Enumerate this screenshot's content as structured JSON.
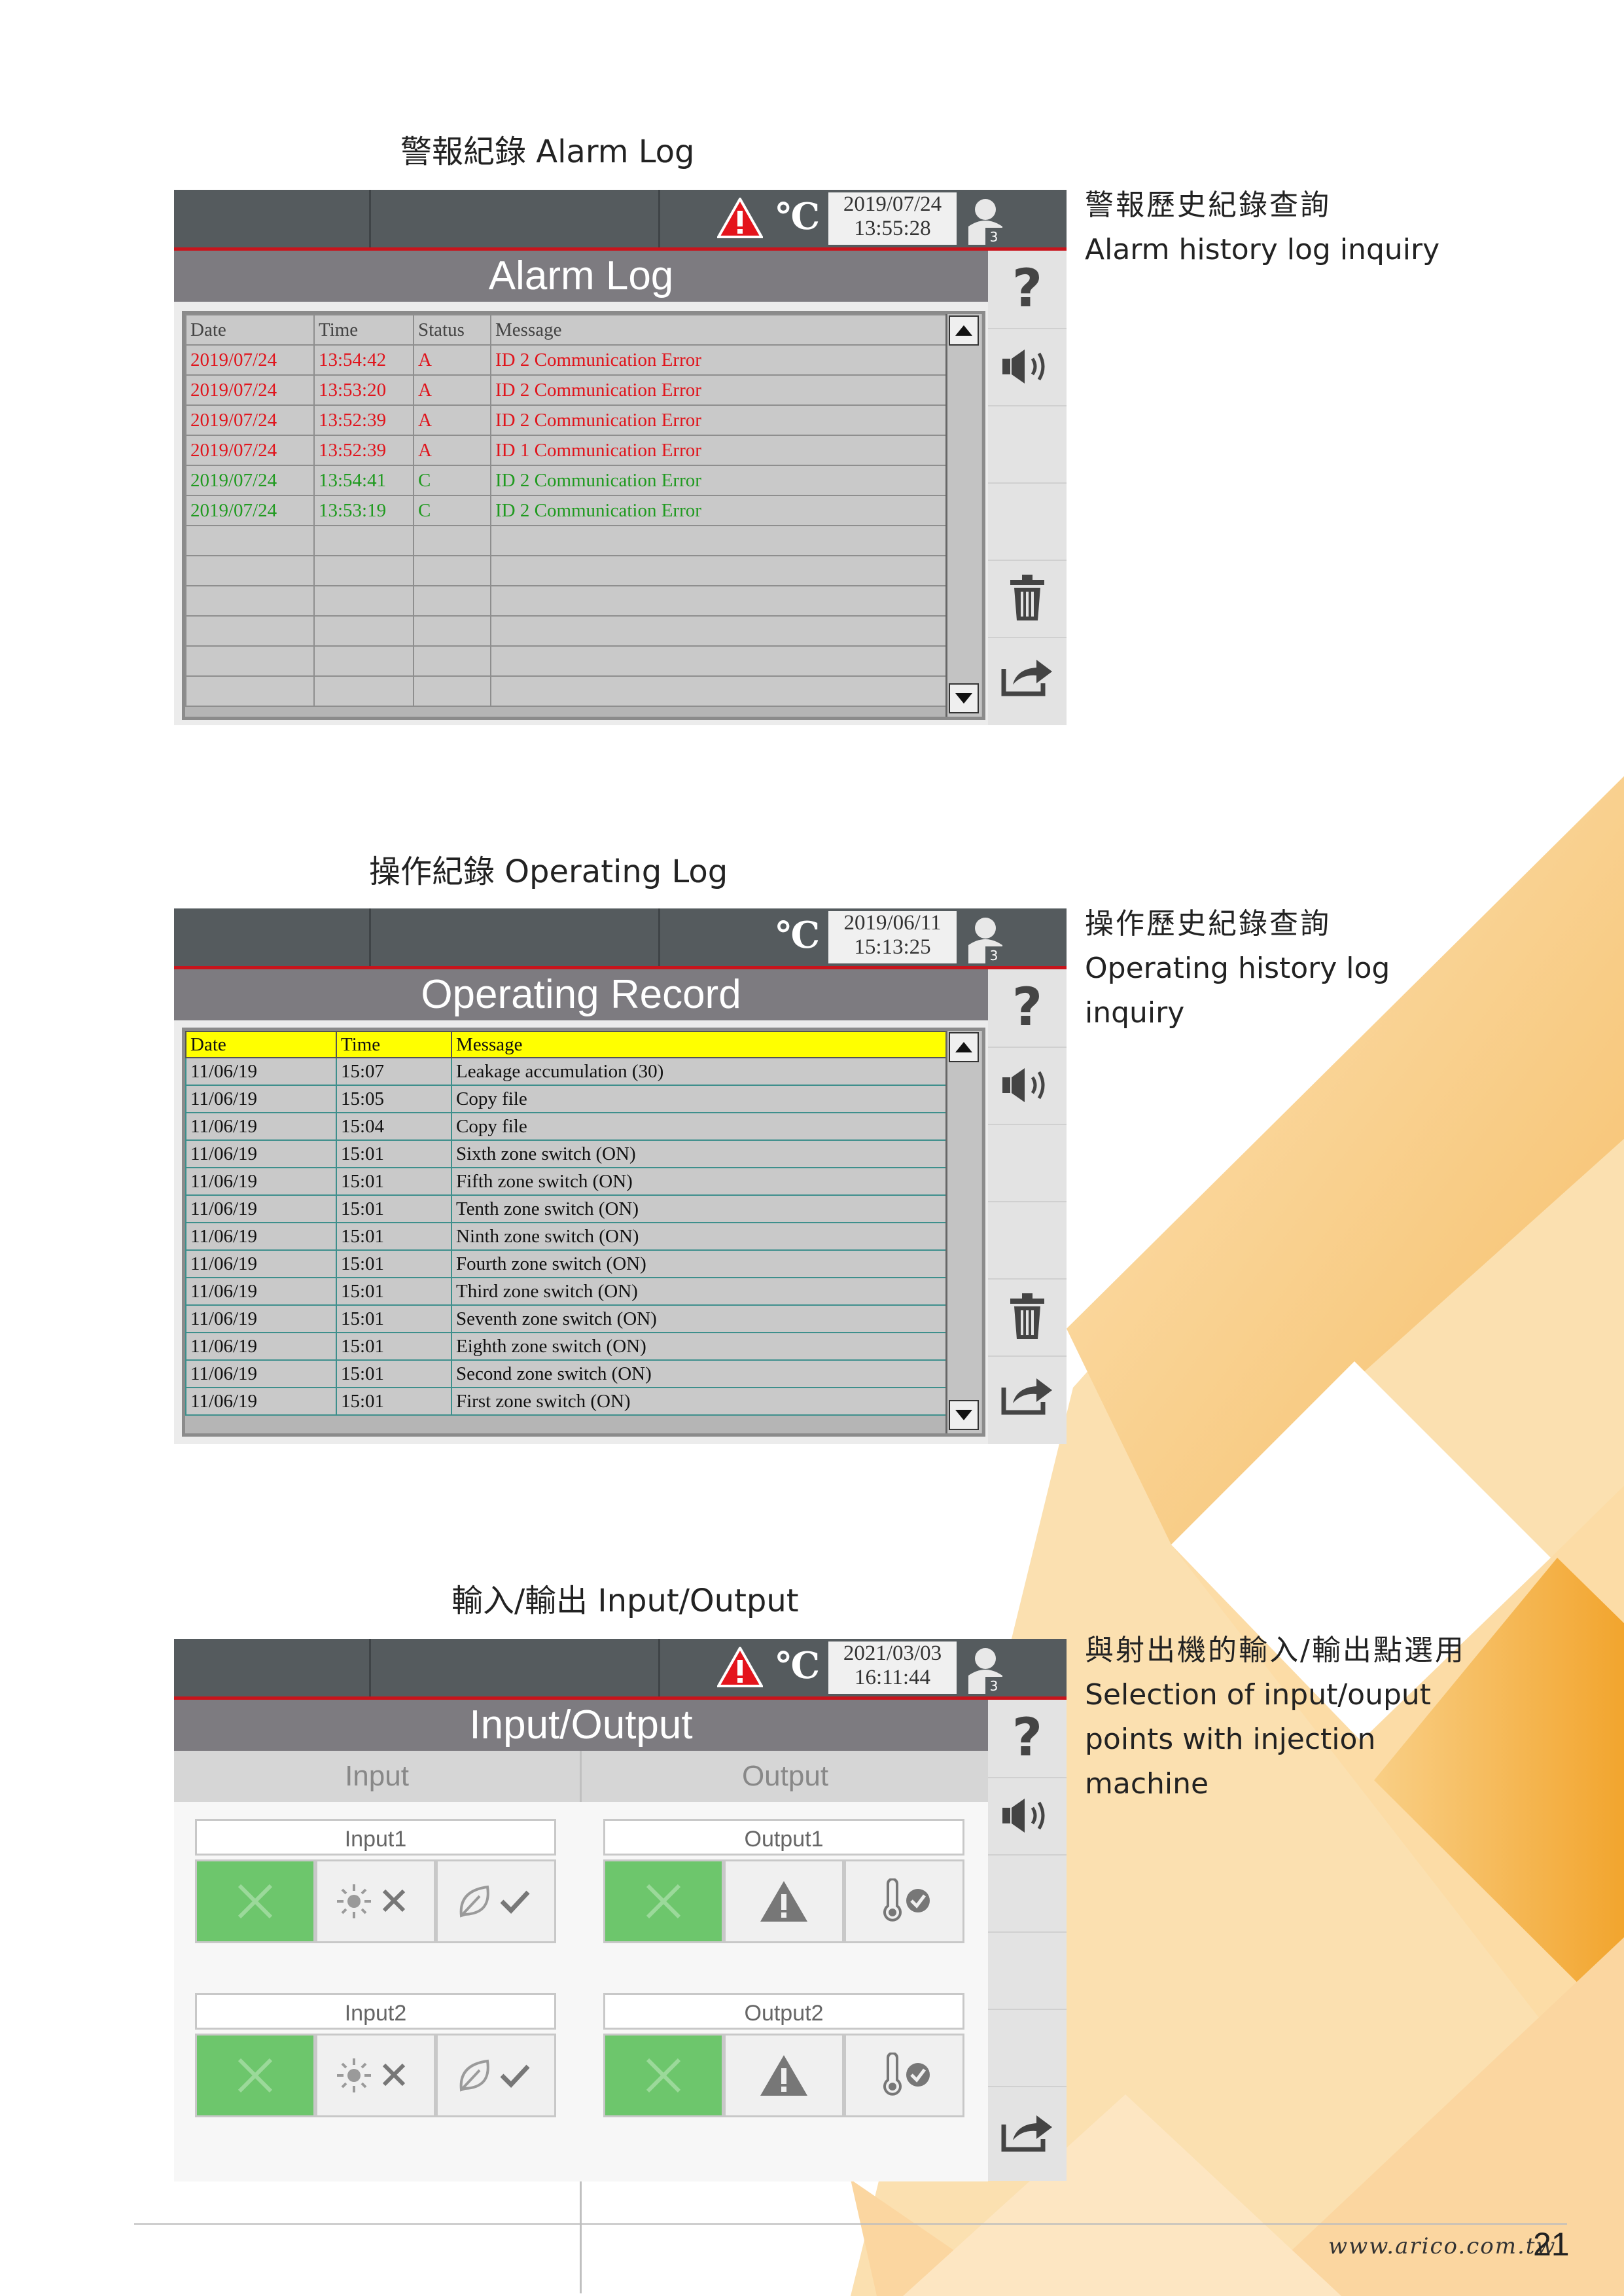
{
  "section1": {
    "heading": "警報紀錄 Alarm Log",
    "side_zh": "警報歷史紀錄查詢",
    "side_en": [
      "Alarm history log inquiry"
    ],
    "screen": {
      "date": "2019/07/24",
      "time": "13:55:28",
      "user_level": "3",
      "degc": "℃",
      "title": "Alarm Log",
      "columns": [
        "Date",
        "Time",
        "Status",
        "Message"
      ],
      "rows": [
        {
          "date": "2019/07/24",
          "time": "13:54:42",
          "status": "A",
          "message": "ID 2 Communication Error",
          "kind": "red"
        },
        {
          "date": "2019/07/24",
          "time": "13:53:20",
          "status": "A",
          "message": "ID 2 Communication Error",
          "kind": "red"
        },
        {
          "date": "2019/07/24",
          "time": "13:52:39",
          "status": "A",
          "message": "ID 2 Communication Error",
          "kind": "red"
        },
        {
          "date": "2019/07/24",
          "time": "13:52:39",
          "status": "A",
          "message": "ID 1 Communication Error",
          "kind": "red"
        },
        {
          "date": "2019/07/24",
          "time": "13:54:41",
          "status": "C",
          "message": "ID 2 Communication Error",
          "kind": "green"
        },
        {
          "date": "2019/07/24",
          "time": "13:53:19",
          "status": "C",
          "message": "ID 2 Communication Error",
          "kind": "green"
        },
        {
          "date": "",
          "time": "",
          "status": "",
          "message": "",
          "kind": "empty"
        },
        {
          "date": "",
          "time": "",
          "status": "",
          "message": "",
          "kind": "empty"
        },
        {
          "date": "",
          "time": "",
          "status": "",
          "message": "",
          "kind": "empty"
        },
        {
          "date": "",
          "time": "",
          "status": "",
          "message": "",
          "kind": "empty"
        },
        {
          "date": "",
          "time": "",
          "status": "",
          "message": "",
          "kind": "empty"
        },
        {
          "date": "",
          "time": "",
          "status": "",
          "message": "",
          "kind": "empty"
        }
      ]
    }
  },
  "section2": {
    "heading": "操作紀錄 Operating Log",
    "side_zh": "操作歷史紀錄查詢",
    "side_en": [
      "Operating history log",
      "inquiry"
    ],
    "screen": {
      "date": "2019/06/11",
      "time": "15:13:25",
      "user_level": "3",
      "degc": "℃",
      "title": "Operating Record",
      "columns": [
        "Date",
        "Time",
        "Message"
      ],
      "rows": [
        {
          "date": "11/06/19",
          "time": "15:07",
          "message": "Leakage accumulation (30)"
        },
        {
          "date": "11/06/19",
          "time": "15:05",
          "message": "Copy file"
        },
        {
          "date": "11/06/19",
          "time": "15:04",
          "message": "Copy file"
        },
        {
          "date": "11/06/19",
          "time": "15:01",
          "message": "Sixth zone switch (ON)"
        },
        {
          "date": "11/06/19",
          "time": "15:01",
          "message": "Fifth zone switch (ON)"
        },
        {
          "date": "11/06/19",
          "time": "15:01",
          "message": "Tenth zone switch (ON)"
        },
        {
          "date": "11/06/19",
          "time": "15:01",
          "message": "Ninth zone switch (ON)"
        },
        {
          "date": "11/06/19",
          "time": "15:01",
          "message": "Fourth zone switch (ON)"
        },
        {
          "date": "11/06/19",
          "time": "15:01",
          "message": "Third zone switch (ON)"
        },
        {
          "date": "11/06/19",
          "time": "15:01",
          "message": "Seventh zone switch (ON)"
        },
        {
          "date": "11/06/19",
          "time": "15:01",
          "message": "Eighth zone switch (ON)"
        },
        {
          "date": "11/06/19",
          "time": "15:01",
          "message": "Second zone switch (ON)"
        },
        {
          "date": "11/06/19",
          "time": "15:01",
          "message": "First zone switch (ON)"
        }
      ]
    }
  },
  "section3": {
    "heading": "輸入/輸出 Input/Output",
    "side_zh": "與射出機的輸入/輸出點選用",
    "side_en": [
      "Selection of input/ouput",
      "points with injection",
      "machine"
    ],
    "screen": {
      "date": "2021/03/03",
      "time": "16:11:44",
      "user_level": "3",
      "degc": "℃",
      "title": "Input/Output",
      "tab_input": "Input",
      "tab_output": "Output",
      "input1": "Input1",
      "input2": "Input2",
      "output1": "Output1",
      "output2": "Output2"
    }
  },
  "footer": {
    "url": "www.arico.com.tw",
    "page": "21"
  },
  "colors": {
    "alarm_active": "#e0141c",
    "alarm_cleared": "#1f9a1f",
    "accent_bar": "#c8141c",
    "header_yellow": "#ffff00",
    "io_selected": "#6dc66c",
    "orange_light": "#fbd9a0",
    "orange_deep": "#f3a93b"
  },
  "icons": [
    "warning-icon",
    "degree-celsius-icon",
    "user-icon",
    "help-icon",
    "speaker-icon",
    "trash-icon",
    "export-icon",
    "scroll-up-icon",
    "scroll-down-icon",
    "close-x-icon",
    "light-off-icon",
    "leaf-check-icon",
    "alert-triangle-icon",
    "thermometer-check-icon"
  ]
}
